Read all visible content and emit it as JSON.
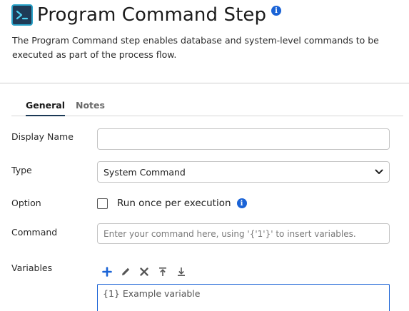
{
  "header": {
    "title": "Program Command Step",
    "description": "The Program Command step enables database and system-level commands to be executed as part of the process flow.",
    "icon": "terminal-icon",
    "info_icon": "info-icon"
  },
  "tabs": [
    {
      "label": "General",
      "active": true
    },
    {
      "label": "Notes",
      "active": false
    }
  ],
  "form": {
    "display_name": {
      "label": "Display Name",
      "value": ""
    },
    "type": {
      "label": "Type",
      "value": "System Command"
    },
    "option": {
      "label": "Option",
      "checkbox_label": "Run once per execution",
      "checked": false
    },
    "command": {
      "label": "Command",
      "placeholder": "Enter your command here, using '{'1'}' to insert variables.",
      "value": ""
    },
    "variables": {
      "label": "Variables",
      "toolbar": [
        "add-icon",
        "edit-icon",
        "delete-icon",
        "move-top-icon",
        "move-bottom-icon"
      ],
      "items": [
        "{1} Example variable"
      ]
    }
  },
  "colors": {
    "accent": "#1a63d6",
    "tab_underline": "#1b3956",
    "icon_bg": "#1f3b57"
  }
}
